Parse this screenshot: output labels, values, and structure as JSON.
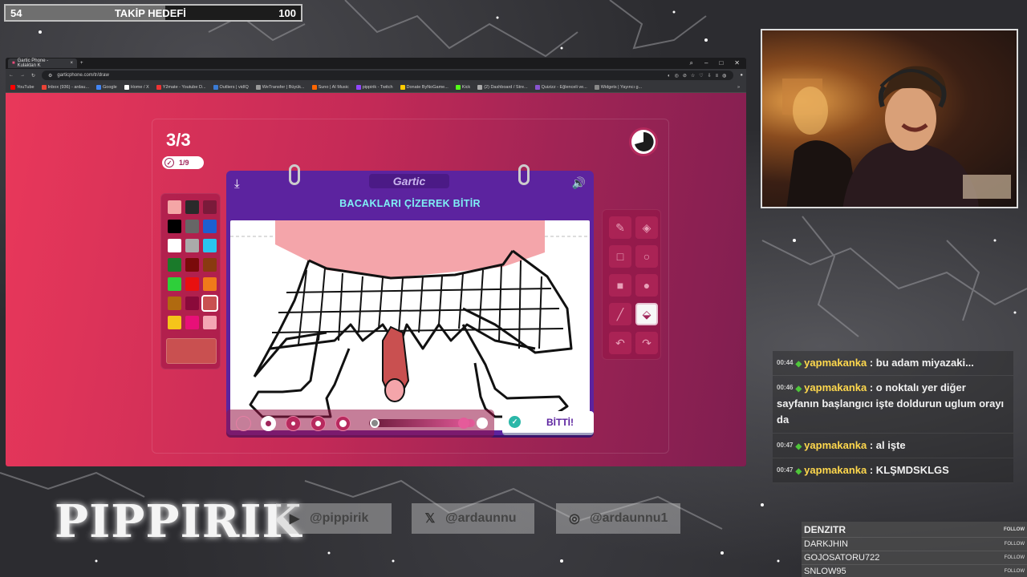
{
  "follow_goal": {
    "current": "54",
    "label": "TAKİP HEDEFİ",
    "target": "100"
  },
  "browser": {
    "tab_title": "Gartic Phone - Kulaktan K",
    "url": "garticphone.com/tr/draw",
    "bookmarks": [
      "YouTube",
      "Inbox (936) - ardau...",
      "Google",
      "Home / X",
      "Y2mate - Youtube D...",
      "Outliers | vidIQ",
      "WeTransfer | Büyük...",
      "Suno | AI Music",
      "pippirik - Twitch",
      "Donate ByNoGame...",
      "Kick",
      "(2) Dashboard / Stre...",
      "Quizizz - Eğlenceli ve...",
      "Widgets | Yayıncı g..."
    ]
  },
  "game": {
    "round": "3/3",
    "done_count": "1/9",
    "logo": "Gartic",
    "task": "BACAKLARI ÇİZEREK BİTİR",
    "done_button": "BİTTİ!",
    "current_color": "#c95050",
    "palette": [
      "#f4a6a6",
      "#2a2a2a",
      "#7a1a3a",
      "#000000",
      "#666666",
      "#1d5fd0",
      "#ffffff",
      "#aaaaaa",
      "#29c4f0",
      "#1a7a2a",
      "#7a0a0a",
      "#8a3a10",
      "#2ecf3a",
      "#e81010",
      "#f07a1a",
      "#b06a10",
      "#8a0a3a",
      "#c95050",
      "#f5c51a",
      "#e81078",
      "#f4a6b4"
    ],
    "tools": [
      "pencil-icon",
      "eraser-icon",
      "square-outline-icon",
      "circle-outline-icon",
      "square-fill-icon",
      "circle-fill-icon",
      "line-icon",
      "bucket-icon",
      "undo-icon",
      "redo-icon"
    ]
  },
  "chat": [
    {
      "time": "00:44",
      "user": "yapmakanka",
      "text": ": bu adam miyazaki..."
    },
    {
      "time": "00:46",
      "user": "yapmakanka",
      "text": ": o noktalı yer diğer sayfanın başlangıcı işte doldurun uglum orayı da"
    },
    {
      "time": "00:47",
      "user": "yapmakanka",
      "text": ": al işte"
    },
    {
      "time": "00:47",
      "user": "yapmakanka",
      "text": ": KLŞMDSKLGS"
    }
  ],
  "brand": "PIPPIRIK",
  "socials": [
    {
      "icon": "youtube-icon",
      "handle": "@pippirik"
    },
    {
      "icon": "x-icon",
      "handle": "@ardaunnu"
    },
    {
      "icon": "instagram-icon",
      "handle": "@ardaunnu1"
    }
  ],
  "followers": {
    "label": "FOLLOW",
    "names": [
      "DENZITR",
      "DARKJHIN",
      "GOJOSATORU722",
      "SNLOW95"
    ]
  }
}
